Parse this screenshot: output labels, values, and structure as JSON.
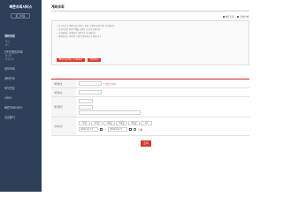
{
  "brand": {
    "logo_text": "빠른조회서비스",
    "logout_label": "로그아웃"
  },
  "sidebar": {
    "items": [
      {
        "label": "계좌조회",
        "active": true
      },
      {
        "label": "입금",
        "active": false
      },
      {
        "label": "카드",
        "active": false
      },
      {
        "label": "인터넷뱅킹조회",
        "active": false
      },
      {
        "label": "외국환",
        "active": false
      },
      {
        "label": "타행조회",
        "active": false
      },
      {
        "label": "정보조회",
        "active": false
      },
      {
        "label": "계좌안내",
        "active": false
      },
      {
        "label": "퇴직연금",
        "active": false
      },
      {
        "label": "서비스",
        "active": false
      },
      {
        "label": "빠른조회서비스",
        "active": false
      },
      {
        "label": "입금통지",
        "active": false
      }
    ]
  },
  "page": {
    "title": "계좌조회"
  },
  "top_links": [
    {
      "label": "빠른조회",
      "icon": "print-icon"
    },
    {
      "label": "화면인쇄",
      "icon": "help-icon"
    }
  ],
  "notice": {
    "lines": [
      "• 본 서비스는 빠른조회 서비스 등록 고객에 한해 이용 가능합니다.",
      "• 조회기간은 최대 3개월 단위로 조회 가능합니다.",
      "• 조회결과는 거래일자 기준으로 표시됩니다.",
      "• 계좌번호는 하이픈(-) 없이 입력하시기 바랍니다."
    ],
    "buttons": [
      {
        "label": "빠른조회서비스 등록/해지"
      },
      {
        "label": "이용안내"
      }
    ]
  },
  "form": {
    "account": {
      "label": "계좌번호",
      "hint": "* 숫자만 입력"
    },
    "password": {
      "label": "비밀번호"
    },
    "birth": {
      "label": "생년월일"
    },
    "period_label": "조회기간",
    "period_buttons": [
      "당일",
      "1주일",
      "1개월",
      "3개월",
      "6개월",
      "1년"
    ],
    "start_date": "2020-10-17",
    "end_date": "2020-10-17",
    "range_sep": "~",
    "check_label": "전체"
  },
  "submit_label": "조회"
}
